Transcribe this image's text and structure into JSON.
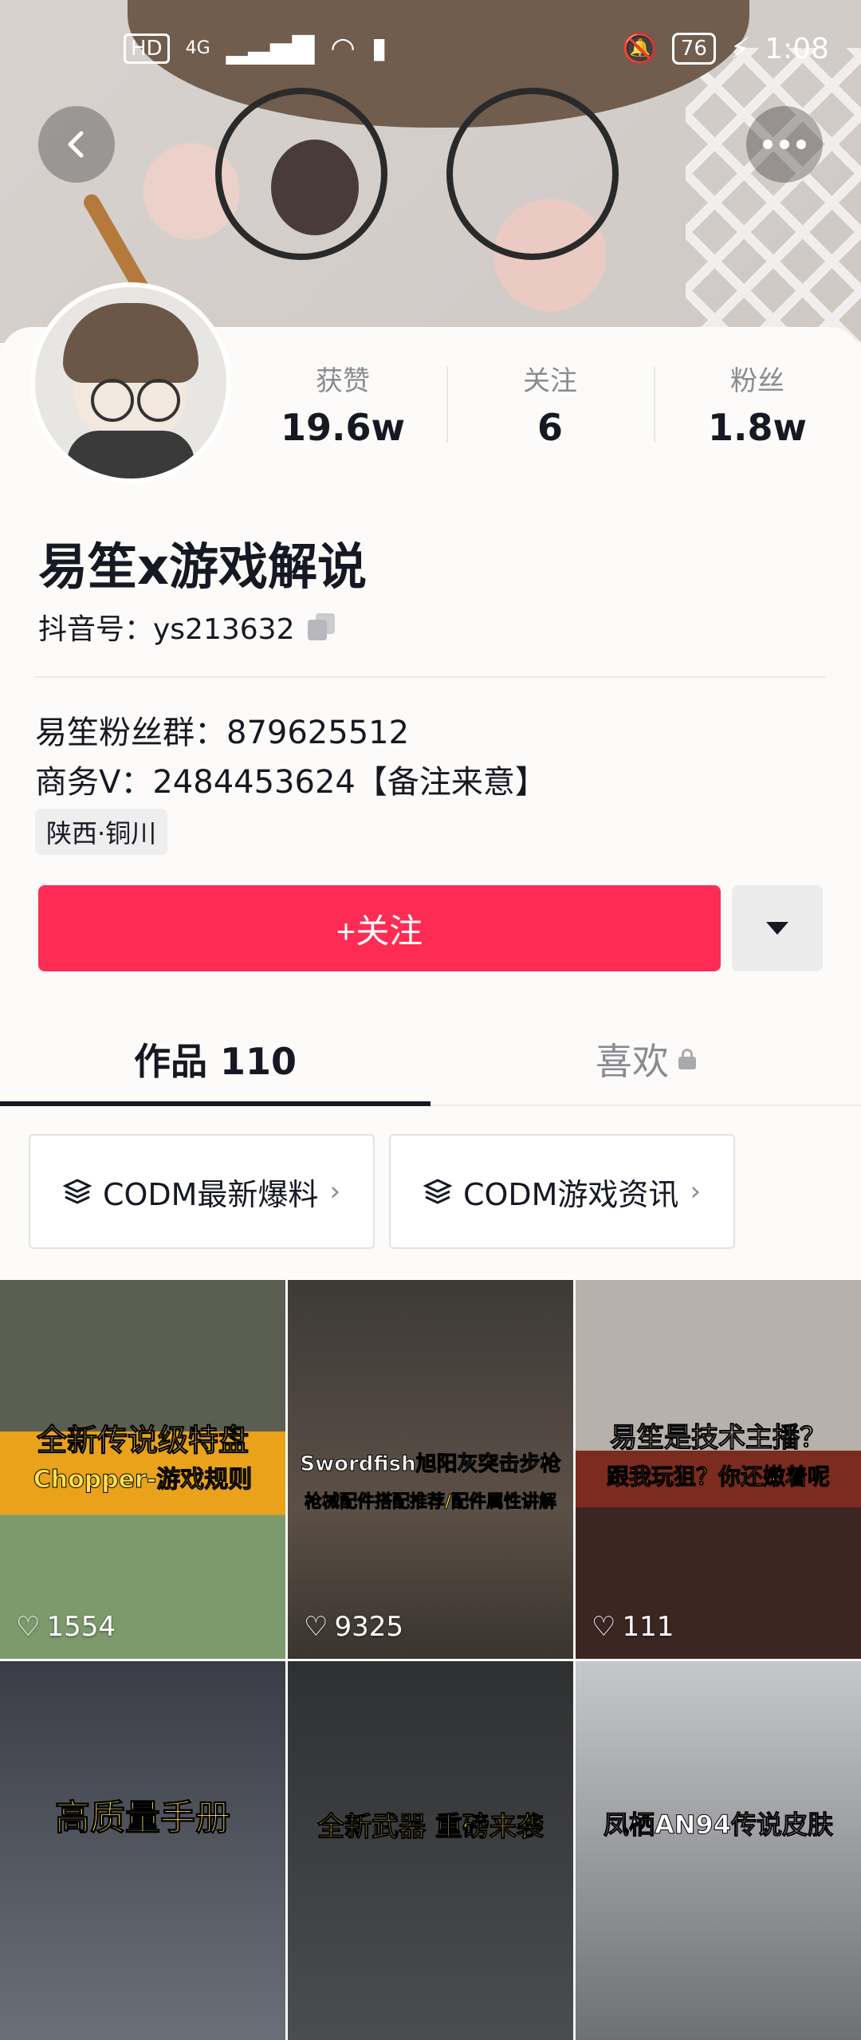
{
  "status_bar": {
    "hd": "HD",
    "network": "4G",
    "battery": "76",
    "time": "1:08"
  },
  "profile": {
    "stats": [
      {
        "label": "获赞",
        "value": "19.6w"
      },
      {
        "label": "关注",
        "value": "6"
      },
      {
        "label": "粉丝",
        "value": "1.8w"
      }
    ],
    "name": "易笙x游戏解说",
    "douyin_id": "抖音号：ys213632",
    "bio_lines": [
      "易笙粉丝群：879625512",
      "商务V：2484453624【备注来意】"
    ],
    "location": "陕西·铜川"
  },
  "actions": {
    "follow_label": "+关注"
  },
  "tabs": {
    "works": "作品 110",
    "likes": "喜欢"
  },
  "collections": [
    {
      "label": "CODM最新爆料"
    },
    {
      "label": "CODM游戏资讯"
    }
  ],
  "videos": [
    {
      "caption_top": "全新传说级特盘",
      "caption_bottom": "Chopper-游戏规则",
      "likes": "1554"
    },
    {
      "caption_top": "Swordfish旭阳灰突击步枪",
      "caption_bottom": "枪械配件搭配推荐/配件属性讲解",
      "likes": "9325"
    },
    {
      "caption_top": "易笙是技术主播？",
      "caption_bottom": "跟我玩狙？你还嫩着呢",
      "likes": "111"
    },
    {
      "caption_top": "高质量手册",
      "caption_bottom": "",
      "likes": ""
    },
    {
      "caption_top": "全新武器 重磅来袭",
      "caption_bottom": "",
      "likes": ""
    },
    {
      "caption_top": "凤栖AN94传说皮肤",
      "caption_bottom": "",
      "likes": ""
    }
  ]
}
